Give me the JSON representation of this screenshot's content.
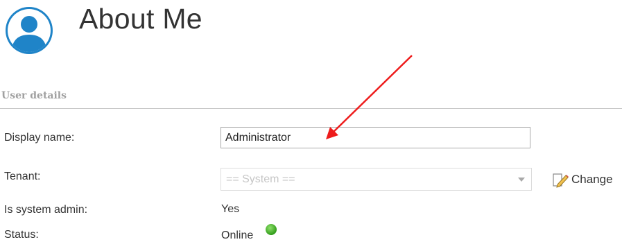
{
  "header": {
    "title": "About Me",
    "avatar_icon": "user-avatar-icon"
  },
  "section": {
    "title": "User details"
  },
  "fields": {
    "display_name": {
      "label": "Display name:",
      "value": "Administrator"
    },
    "tenant": {
      "label": "Tenant:",
      "value": "== System ==",
      "change_label": "Change",
      "change_icon": "edit-icon"
    },
    "is_system_admin": {
      "label": "Is system admin:",
      "value": "Yes"
    },
    "status": {
      "label": "Status:",
      "value": "Online",
      "indicator_icon": "status-online-icon"
    }
  },
  "colors": {
    "avatar_blue": "#1f84c8",
    "annotation_red": "#ee1c1c",
    "status_green": "#3cb324",
    "section_text": "#a0a0a0"
  }
}
